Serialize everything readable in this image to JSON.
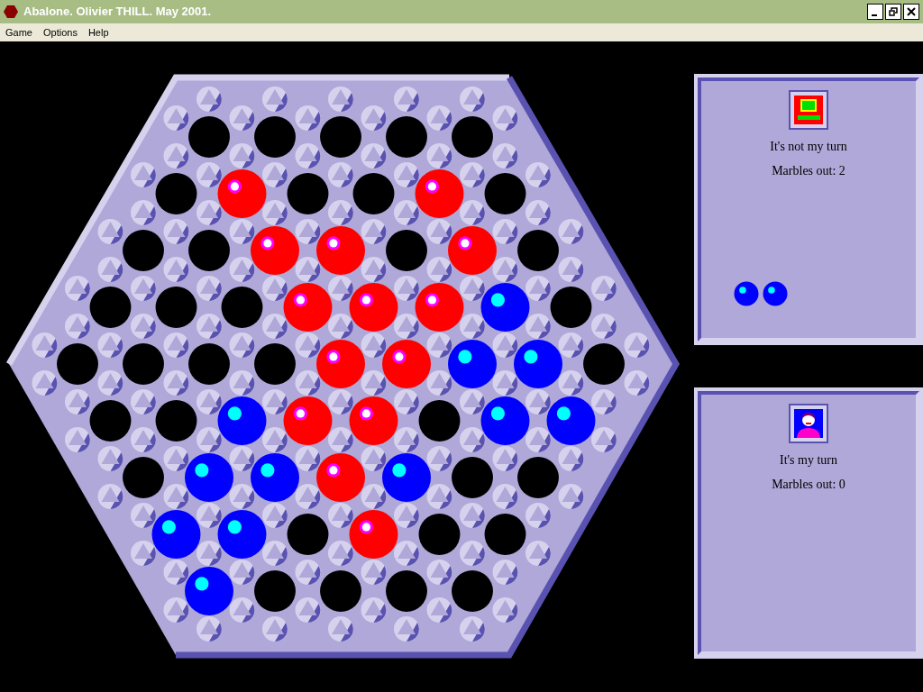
{
  "window": {
    "title": "Abalone. Olivier THILL. May 2001."
  },
  "menu": [
    "Game",
    "Options",
    "Help"
  ],
  "board": {
    "rows": [
      [
        {
          "kind": "empty"
        },
        {
          "kind": "empty"
        },
        {
          "kind": "empty"
        },
        {
          "kind": "empty"
        },
        {
          "kind": "empty"
        }
      ],
      [
        {
          "kind": "empty"
        },
        {
          "kind": "red"
        },
        {
          "kind": "empty"
        },
        {
          "kind": "empty"
        },
        {
          "kind": "red"
        },
        {
          "kind": "empty"
        }
      ],
      [
        {
          "kind": "empty"
        },
        {
          "kind": "empty"
        },
        {
          "kind": "red"
        },
        {
          "kind": "red"
        },
        {
          "kind": "empty"
        },
        {
          "kind": "red"
        },
        {
          "kind": "empty"
        }
      ],
      [
        {
          "kind": "empty"
        },
        {
          "kind": "empty"
        },
        {
          "kind": "empty"
        },
        {
          "kind": "red"
        },
        {
          "kind": "red"
        },
        {
          "kind": "red"
        },
        {
          "kind": "blue"
        },
        {
          "kind": "empty"
        }
      ],
      [
        {
          "kind": "empty"
        },
        {
          "kind": "empty"
        },
        {
          "kind": "empty"
        },
        {
          "kind": "empty"
        },
        {
          "kind": "red"
        },
        {
          "kind": "red"
        },
        {
          "kind": "blue"
        },
        {
          "kind": "blue"
        },
        {
          "kind": "empty"
        }
      ],
      [
        {
          "kind": "empty"
        },
        {
          "kind": "empty"
        },
        {
          "kind": "blue"
        },
        {
          "kind": "red"
        },
        {
          "kind": "red"
        },
        {
          "kind": "empty"
        },
        {
          "kind": "blue"
        },
        {
          "kind": "blue"
        }
      ],
      [
        {
          "kind": "empty"
        },
        {
          "kind": "blue"
        },
        {
          "kind": "blue"
        },
        {
          "kind": "red"
        },
        {
          "kind": "blue"
        },
        {
          "kind": "empty"
        },
        {
          "kind": "empty"
        }
      ],
      [
        {
          "kind": "blue"
        },
        {
          "kind": "blue"
        },
        {
          "kind": "empty"
        },
        {
          "kind": "red"
        },
        {
          "kind": "empty"
        },
        {
          "kind": "empty"
        }
      ],
      [
        {
          "kind": "blue"
        },
        {
          "kind": "empty"
        },
        {
          "kind": "empty"
        },
        {
          "kind": "empty"
        },
        {
          "kind": "empty"
        }
      ]
    ]
  },
  "players": [
    {
      "avatar": {
        "kind": "computer"
      },
      "status": "It's not my turn",
      "marbles_out": "Marbles out: 2",
      "captured": [
        {
          "kind": "blue"
        },
        {
          "kind": "blue"
        }
      ]
    },
    {
      "avatar": {
        "kind": "person"
      },
      "status": "It's my turn",
      "marbles_out": "Marbles out: 0"
    }
  ]
}
